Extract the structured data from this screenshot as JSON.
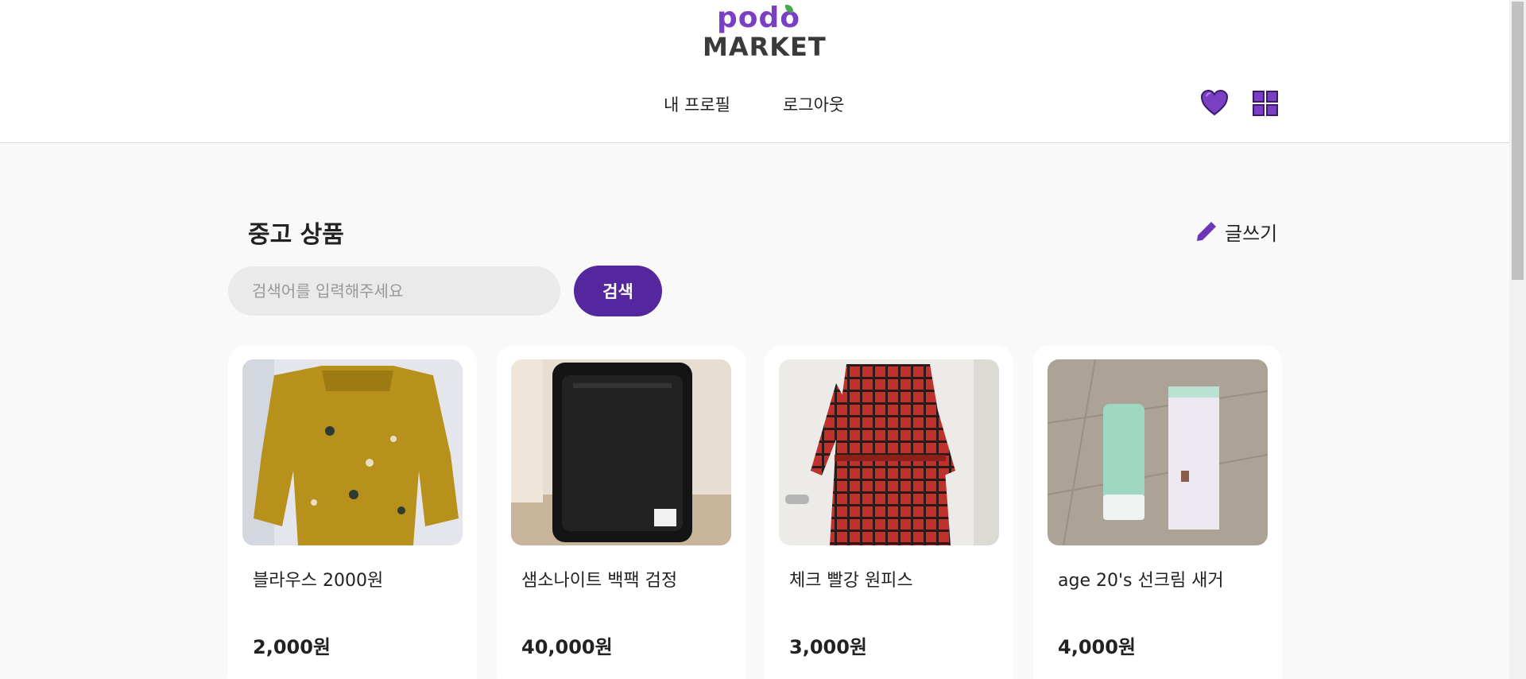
{
  "brand": {
    "logo_top": "podo",
    "logo_bottom": "MARKET"
  },
  "nav": {
    "profile": "내 프로필",
    "logout": "로그아웃"
  },
  "icons": {
    "wishlist": "heart-icon",
    "menu": "grid-icon",
    "write": "pencil-icon"
  },
  "colors": {
    "primary": "#54279e",
    "accent": "#7b3fc4",
    "leaf": "#49a84a"
  },
  "section": {
    "title": "중고 상품",
    "write_label": "글쓰기"
  },
  "search": {
    "placeholder": "검색어를 입력해주세요",
    "button_label": "검색"
  },
  "products": [
    {
      "title": "블라우스 2000원",
      "price": "2,000원"
    },
    {
      "title": "샘소나이트 백팩 검정",
      "price": "40,000원"
    },
    {
      "title": "체크 빨강 원피스",
      "price": "3,000원"
    },
    {
      "title": "age 20's 선크림 새거",
      "price": "4,000원"
    }
  ]
}
